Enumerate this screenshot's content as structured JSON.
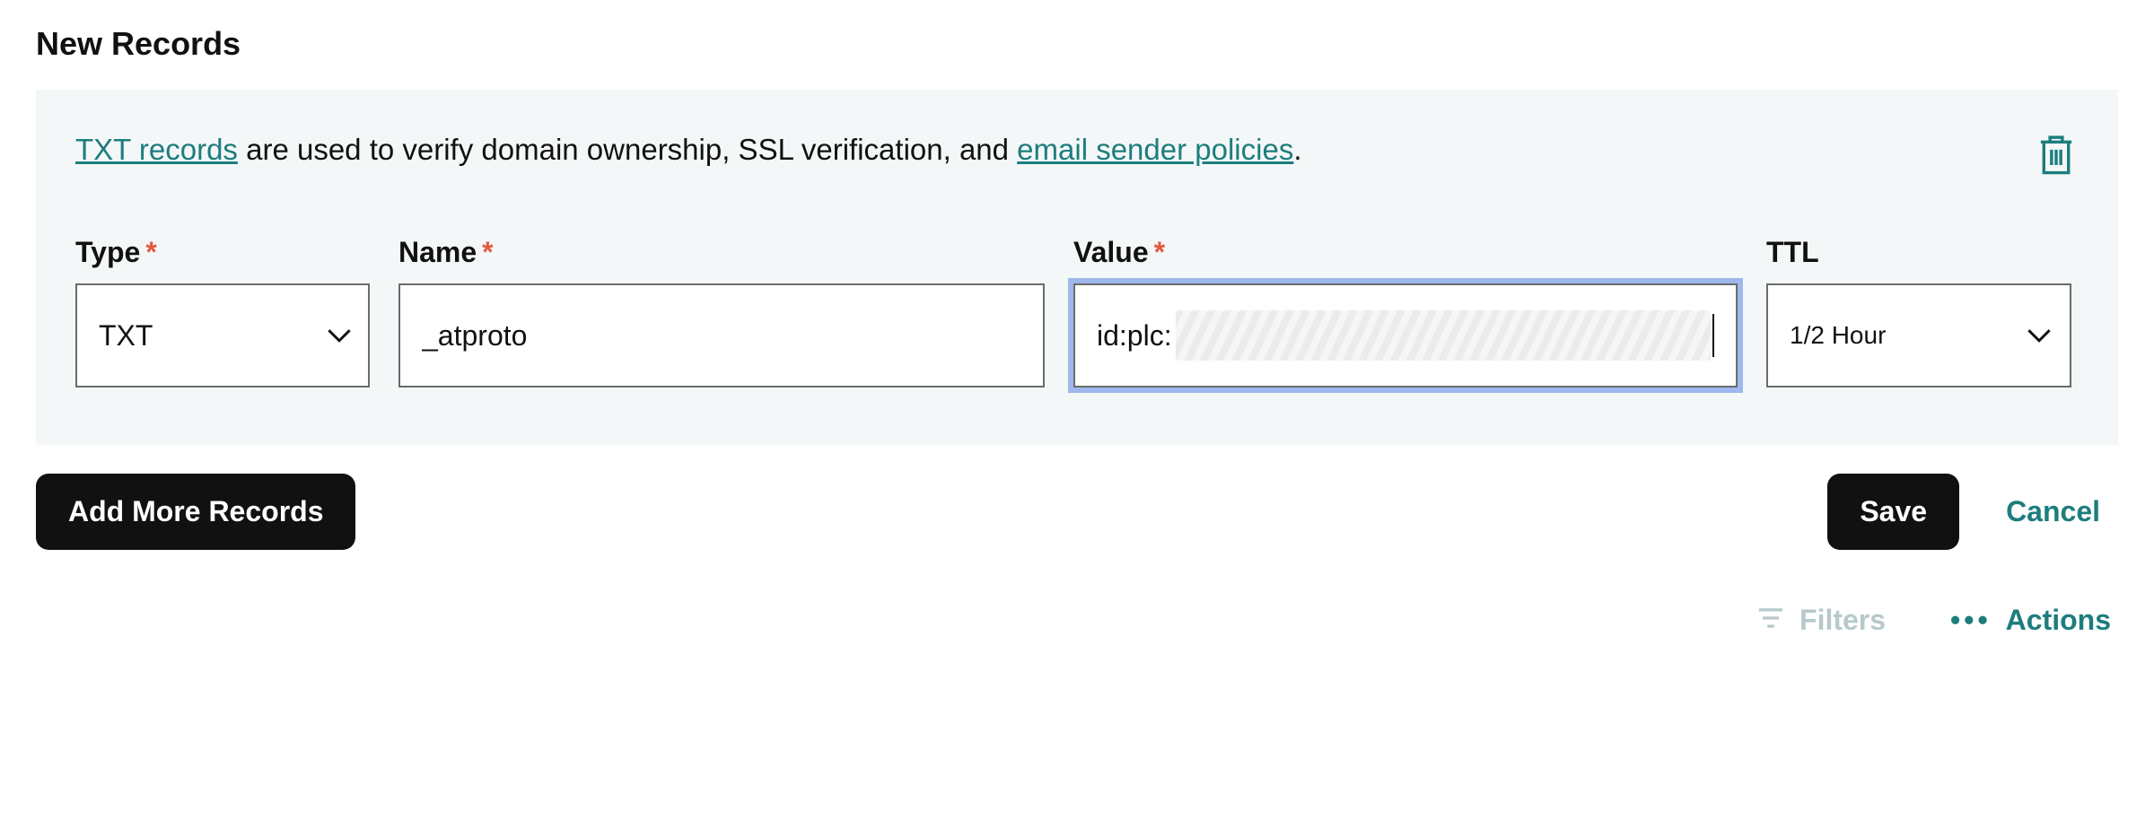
{
  "heading": "New Records",
  "description": {
    "link1_text": "TXT records",
    "middle_text": " are used to verify domain ownership, SSL verification, and ",
    "link2_text": "email sender policies",
    "end_text": "."
  },
  "fields": {
    "type": {
      "label": "Type",
      "value": "TXT"
    },
    "name": {
      "label": "Name",
      "value": "_atproto"
    },
    "value": {
      "label": "Value",
      "prefix": "id:plc:"
    },
    "ttl": {
      "label": "TTL",
      "value": "1/2 Hour"
    }
  },
  "buttons": {
    "add_more": "Add More Records",
    "save": "Save",
    "cancel": "Cancel"
  },
  "footer": {
    "filters": "Filters",
    "actions": "Actions"
  }
}
